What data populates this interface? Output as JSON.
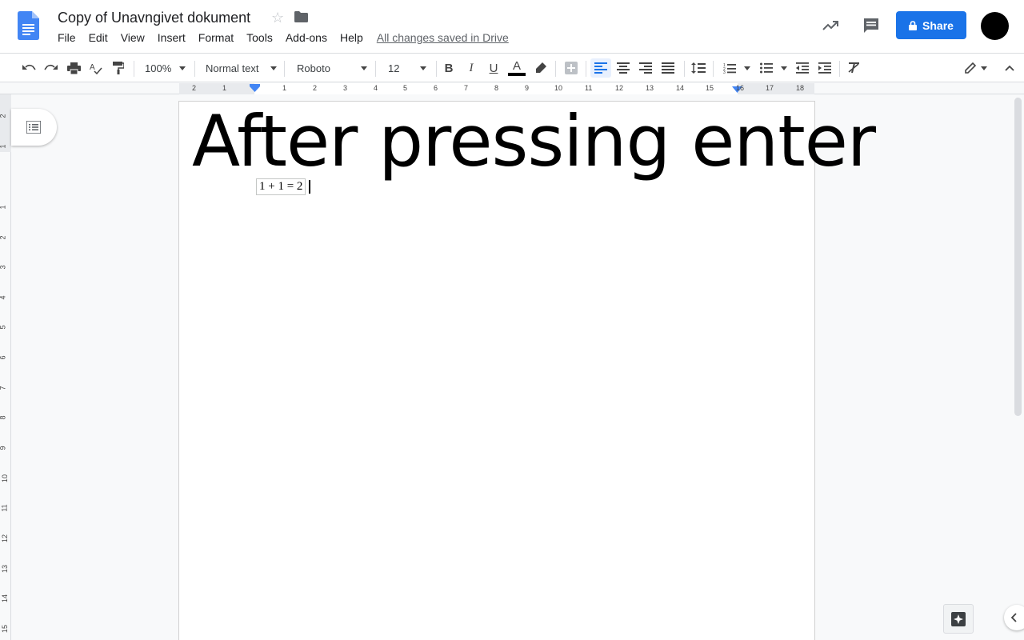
{
  "document": {
    "title": "Copy of Unavngivet dokument",
    "saved_status": "All changes saved in Drive",
    "heading_text": "After pressing enter",
    "equation_text": "1 + 1 = 2"
  },
  "menu": {
    "items": [
      "File",
      "Edit",
      "View",
      "Insert",
      "Format",
      "Tools",
      "Add-ons",
      "Help"
    ]
  },
  "header": {
    "share_label": "Share"
  },
  "toolbar": {
    "zoom": "100%",
    "style": "Normal text",
    "font": "Roboto",
    "font_size": "12",
    "bold": "B",
    "italic": "I",
    "underline": "U",
    "text_color_letter": "A"
  },
  "ruler": {
    "horizontal_labels": [
      "2",
      "1",
      "1",
      "2",
      "3",
      "4",
      "5",
      "6",
      "7",
      "8",
      "9",
      "10",
      "11",
      "12",
      "13",
      "14",
      "15",
      "16",
      "17",
      "18"
    ],
    "vertical_labels": [
      "2",
      "1",
      "1",
      "2",
      "3",
      "4",
      "5",
      "6",
      "7",
      "8",
      "9",
      "10",
      "11",
      "12",
      "13",
      "14",
      "15"
    ]
  },
  "colors": {
    "brand_blue": "#1a73e8",
    "docs_blue": "#4285f4",
    "text_color_bar": "#000000"
  },
  "icons": [
    "docs-logo-icon",
    "star-icon",
    "folder-icon",
    "activity-trend-icon",
    "comment-icon",
    "lock-icon",
    "undo-icon",
    "redo-icon",
    "print-icon",
    "spellcheck-icon",
    "paint-format-icon",
    "highlighter-icon",
    "insert-link-icon",
    "align-left-icon",
    "align-center-icon",
    "align-right-icon",
    "align-justify-icon",
    "line-spacing-icon",
    "numbered-list-icon",
    "bulleted-list-icon",
    "decrease-indent-icon",
    "increase-indent-icon",
    "clear-formatting-icon",
    "pencil-edit-icon",
    "collapse-icon",
    "outline-icon",
    "explore-icon",
    "chevron-left-icon"
  ]
}
